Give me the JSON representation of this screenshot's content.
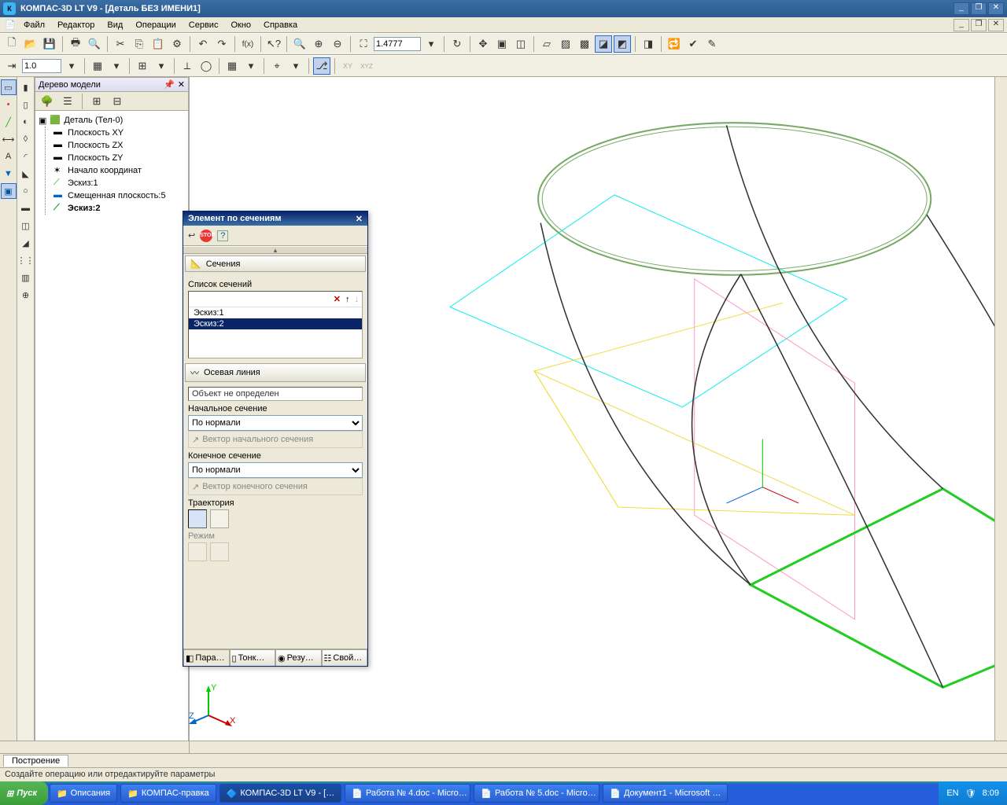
{
  "app": {
    "title": "КОМПАС-3D LT V9 - [Деталь БЕЗ ИМЕНИ1]"
  },
  "menu": {
    "file": "Файл",
    "edit": "Редактор",
    "view": "Вид",
    "operations": "Операции",
    "service": "Сервис",
    "window": "Окно",
    "help": "Справка"
  },
  "toolbar": {
    "zoom_value": "1.4777",
    "scale_value": "1.0"
  },
  "tree": {
    "title": "Дерево модели",
    "root": "Деталь (Тел-0)",
    "items": [
      "Плоскость XY",
      "Плоскость ZX",
      "Плоскость ZY",
      "Начало координат",
      "Эскиз:1",
      "Смещенная плоскость:5",
      "Эскиз:2"
    ]
  },
  "dialog": {
    "title": "Элемент по сечениям",
    "sections_hdr": "Сечения",
    "list_label": "Список сечений",
    "list_items": [
      "Эскиз:1",
      "Эскиз:2"
    ],
    "axis_hdr": "Осевая линия",
    "axis_value": "Объект не определен",
    "start_label": "Начальное сечение",
    "start_value": "По нормали",
    "start_vec": "Вектор начального сечения",
    "end_label": "Конечное сечение",
    "end_value": "По нормали",
    "end_vec": "Вектор конечного сечения",
    "traj_label": "Траектория",
    "mode_label": "Режим",
    "tabs": [
      "Пара…",
      "Тонк…",
      "Резу…",
      "Свой…"
    ]
  },
  "bottom": {
    "tab": "Построение"
  },
  "status": {
    "text": "Создайте операцию или отредактируйте параметры"
  },
  "taskbar": {
    "start": "Пуск",
    "items": [
      "Описания",
      "КОМПАС-правка",
      "КОМПАС-3D LT V9 - […",
      "Работа № 4.doc - Micro…",
      "Работа № 5.doc - Micro…",
      "Документ1 - Microsoft …"
    ],
    "lang": "EN",
    "time": "8:09"
  }
}
